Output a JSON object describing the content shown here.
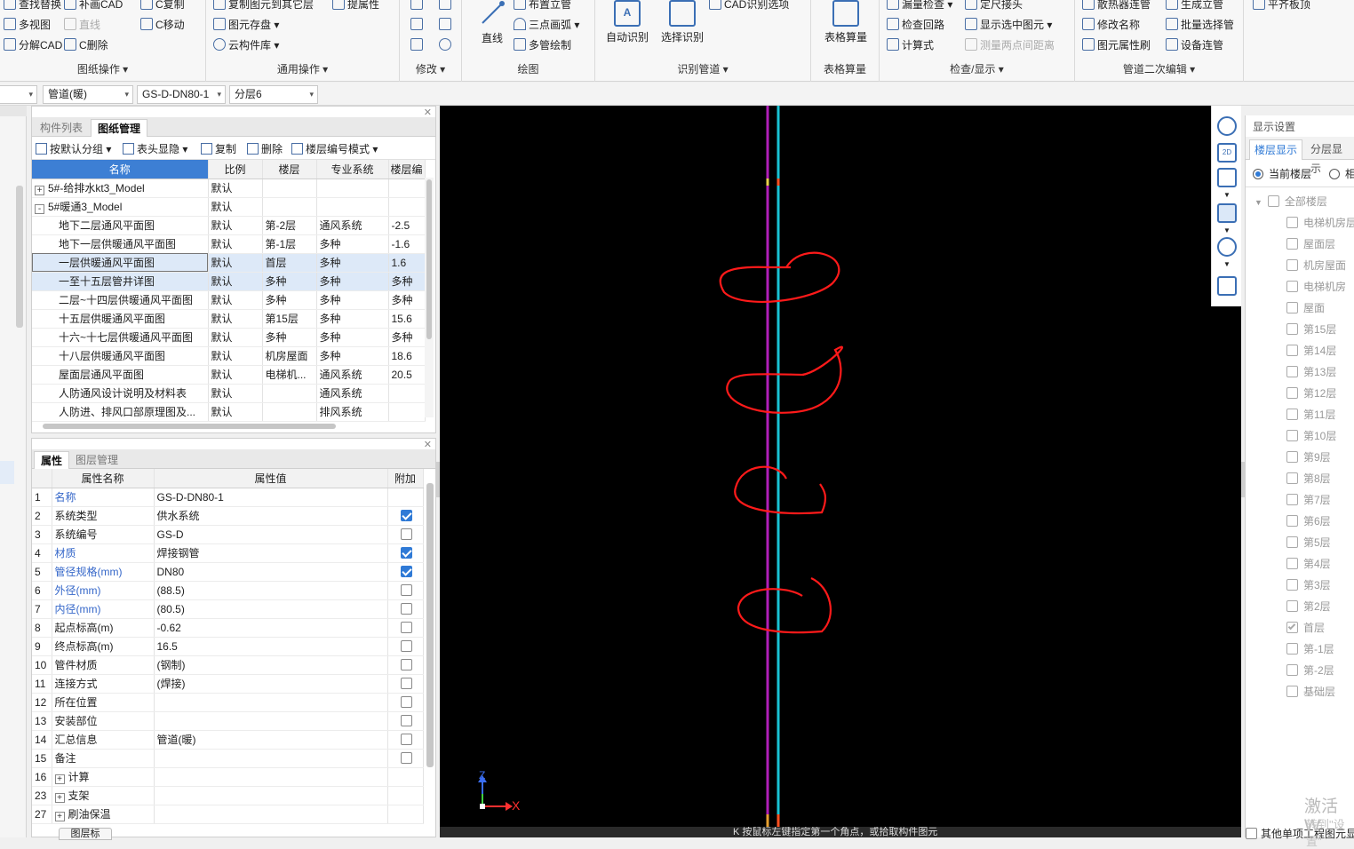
{
  "ribbon": {
    "groups": [
      {
        "label": "图纸操作 ▾"
      },
      {
        "label": "通用操作 ▾"
      },
      {
        "label": "修改 ▾"
      },
      {
        "label": "绘图"
      },
      {
        "label": "识别管道 ▾"
      },
      {
        "label": "表格算量"
      },
      {
        "label": "检查/显示 ▾"
      },
      {
        "label": "管道二次编辑 ▾"
      }
    ],
    "items": {
      "find_replace": "查找替换",
      "fill_cad": "补画CAD",
      "c_copy": "C复制",
      "multi_view": "多视图",
      "line_dis": "直线",
      "c_move": "C移动",
      "explode_cad": "分解CAD",
      "c_delete": "C删除",
      "copy_to_floor": "复制图元到其它层",
      "extract_attr": "提属性",
      "element_save": "图元存盘 ▾",
      "cloud_lib": "云构件库 ▾",
      "line": "直线",
      "arrange_riser": "布置立管",
      "three_point_arc": "三点画弧 ▾",
      "multi_pipe": "多管绘制",
      "auto_recognize": "自动识别",
      "select_recognize": "选择识别",
      "cad_options": "CAD识别选项",
      "table_calc": "表格算量",
      "leak_check": "漏量检查 ▾",
      "fixed_joint": "定尺接头",
      "check_loop": "检查回路",
      "show_selected": "显示选中图元 ▾",
      "formula": "计算式",
      "measure_dist": "测量两点间距离",
      "radiator_connect": "散热器连管",
      "gen_riser": "生成立管",
      "rename": "修改名称",
      "batch_select": "批量选择管",
      "element_brush": "图元属性刷",
      "device_connect": "设备连管",
      "flush_top": "平齐板顶"
    }
  },
  "toolbar2": {
    "sel1": "",
    "sel2": "管道(暖)",
    "sel3": "GS-D-DN80-1",
    "sel4": "分层6"
  },
  "drawing_panel": {
    "tabs": [
      "构件列表",
      "图纸管理"
    ],
    "actions": {
      "group": "按默认分组 ▾",
      "header_display": "表头显隐 ▾",
      "copy": "复制",
      "delete": "删除",
      "floor_mode": "楼层编号模式 ▾"
    },
    "columns": [
      "名称",
      "比例",
      "楼层",
      "专业系统",
      "楼层编"
    ],
    "rows": [
      {
        "exp": "+",
        "name": "5#-给排水kt3_Model",
        "ratio": "默认",
        "floor": "",
        "sys": "",
        "fno": ""
      },
      {
        "exp": "-",
        "name": "5#暖通3_Model",
        "ratio": "默认",
        "floor": "",
        "sys": "",
        "fno": ""
      },
      {
        "exp": "",
        "name": "地下二层通风平面图",
        "ratio": "默认",
        "floor": "第-2层",
        "sys": "通风系统",
        "fno": "-2.5"
      },
      {
        "exp": "",
        "name": "地下一层供暖通风平面图",
        "ratio": "默认",
        "floor": "第-1层",
        "sys": "多种",
        "fno": "-1.6"
      },
      {
        "exp": "",
        "name": "一层供暖通风平面图",
        "ratio": "默认",
        "floor": "首层",
        "sys": "多种",
        "fno": "1.6"
      },
      {
        "exp": "",
        "name": "一至十五层管井详图",
        "ratio": "默认",
        "floor": "多种",
        "sys": "多种",
        "fno": "多种"
      },
      {
        "exp": "",
        "name": "二层~十四层供暖通风平面图",
        "ratio": "默认",
        "floor": "多种",
        "sys": "多种",
        "fno": "多种"
      },
      {
        "exp": "",
        "name": "十五层供暖通风平面图",
        "ratio": "默认",
        "floor": "第15层",
        "sys": "多种",
        "fno": "15.6"
      },
      {
        "exp": "",
        "name": "十六~十七层供暖通风平面图",
        "ratio": "默认",
        "floor": "多种",
        "sys": "多种",
        "fno": "多种"
      },
      {
        "exp": "",
        "name": "十八层供暖通风平面图",
        "ratio": "默认",
        "floor": "机房屋面",
        "sys": "多种",
        "fno": "18.6"
      },
      {
        "exp": "",
        "name": "屋面层通风平面图",
        "ratio": "默认",
        "floor": "电梯机...",
        "sys": "通风系统",
        "fno": "20.5"
      },
      {
        "exp": "",
        "name": "人防通风设计说明及材料表",
        "ratio": "默认",
        "floor": "",
        "sys": "通风系统",
        "fno": ""
      },
      {
        "exp": "",
        "name": "人防进、排风口部原理图及...",
        "ratio": "默认",
        "floor": "",
        "sys": "排风系统",
        "fno": ""
      }
    ]
  },
  "props_panel": {
    "tabs": [
      "属性",
      "图层管理"
    ],
    "columns": [
      "属性名称",
      "属性值",
      "附加"
    ],
    "rows": [
      {
        "no": "1",
        "name": "名称",
        "value": "GS-D-DN80-1",
        "blue": true,
        "cb": "none",
        "exp": ""
      },
      {
        "no": "2",
        "name": "系统类型",
        "value": "供水系统",
        "blue": false,
        "cb": "on",
        "exp": ""
      },
      {
        "no": "3",
        "name": "系统编号",
        "value": "GS-D",
        "blue": false,
        "cb": "off",
        "exp": ""
      },
      {
        "no": "4",
        "name": "材质",
        "value": "焊接钢管",
        "blue": true,
        "cb": "on",
        "exp": ""
      },
      {
        "no": "5",
        "name": "管径规格(mm)",
        "value": "DN80",
        "blue": true,
        "cb": "on",
        "exp": ""
      },
      {
        "no": "6",
        "name": "外径(mm)",
        "value": "(88.5)",
        "blue": true,
        "cb": "off",
        "exp": ""
      },
      {
        "no": "7",
        "name": "内径(mm)",
        "value": "(80.5)",
        "blue": true,
        "cb": "off",
        "exp": ""
      },
      {
        "no": "8",
        "name": "起点标高(m)",
        "value": "-0.62",
        "blue": false,
        "cb": "off",
        "exp": ""
      },
      {
        "no": "9",
        "name": "终点标高(m)",
        "value": "16.5",
        "blue": false,
        "cb": "off",
        "exp": ""
      },
      {
        "no": "10",
        "name": "管件材质",
        "value": "(钢制)",
        "blue": false,
        "cb": "off",
        "exp": ""
      },
      {
        "no": "11",
        "name": "连接方式",
        "value": "(焊接)",
        "blue": false,
        "cb": "off",
        "exp": ""
      },
      {
        "no": "12",
        "name": "所在位置",
        "value": "",
        "blue": false,
        "cb": "off",
        "exp": ""
      },
      {
        "no": "13",
        "name": "安装部位",
        "value": "",
        "blue": false,
        "cb": "off",
        "exp": ""
      },
      {
        "no": "14",
        "name": "汇总信息",
        "value": "管道(暖)",
        "blue": false,
        "cb": "off",
        "exp": ""
      },
      {
        "no": "15",
        "name": "备注",
        "value": "",
        "blue": false,
        "cb": "off",
        "exp": ""
      },
      {
        "no": "16",
        "name": "计算",
        "value": "",
        "blue": false,
        "cb": "none",
        "exp": "+"
      },
      {
        "no": "23",
        "name": "支架",
        "value": "",
        "blue": false,
        "cb": "none",
        "exp": "+"
      },
      {
        "no": "27",
        "name": "刷油保温",
        "value": "",
        "blue": false,
        "cb": "none",
        "exp": "+"
      }
    ],
    "bottom_button": "图层标"
  },
  "viewport": {
    "axis_x": "X",
    "axis_z": "Z",
    "status_text": "K 按鼠标左键指定第一个角点，或拾取构件图元"
  },
  "display_panel": {
    "title": "显示设置",
    "tabs": [
      "楼层显示",
      "分层显示"
    ],
    "radio_current": "当前楼层",
    "radio_other": "相",
    "tree_root": "全部楼层",
    "floors": [
      {
        "name": "电梯机房层",
        "checked": false
      },
      {
        "name": "屋面层",
        "checked": false
      },
      {
        "name": "机房屋面",
        "checked": false
      },
      {
        "name": "电梯机房",
        "checked": false
      },
      {
        "name": "屋面",
        "checked": false
      },
      {
        "name": "第15层",
        "checked": false
      },
      {
        "name": "第14层",
        "checked": false
      },
      {
        "name": "第13层",
        "checked": false
      },
      {
        "name": "第12层",
        "checked": false
      },
      {
        "name": "第11层",
        "checked": false
      },
      {
        "name": "第10层",
        "checked": false
      },
      {
        "name": "第9层",
        "checked": false
      },
      {
        "name": "第8层",
        "checked": false
      },
      {
        "name": "第7层",
        "checked": false
      },
      {
        "name": "第6层",
        "checked": false
      },
      {
        "name": "第5层",
        "checked": false
      },
      {
        "name": "第4层",
        "checked": false
      },
      {
        "name": "第3层",
        "checked": false
      },
      {
        "name": "第2层",
        "checked": false
      },
      {
        "name": "首层",
        "checked": true
      },
      {
        "name": "第-1层",
        "checked": false
      },
      {
        "name": "第-2层",
        "checked": false
      },
      {
        "name": "基础层",
        "checked": false
      }
    ],
    "footer": "其他单项工程图元显",
    "watermark": "激活 W",
    "watermark2": "转到\"设置\""
  },
  "colors": {
    "pipe_magenta": "#b01fb8",
    "pipe_cyan": "#19c3d4",
    "annotation_red": "#ff1a1a",
    "accent_blue": "#2f7ad6"
  }
}
